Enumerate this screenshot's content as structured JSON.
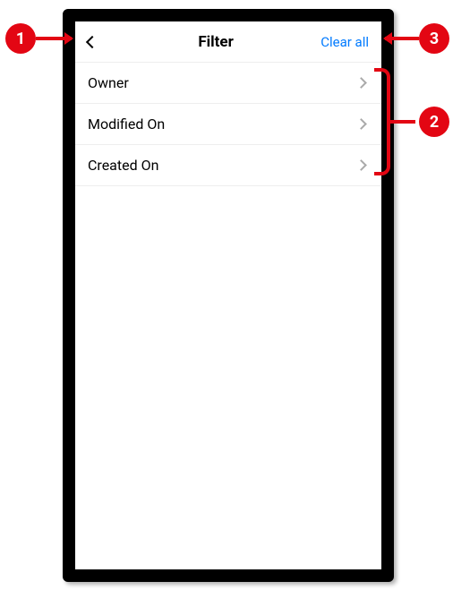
{
  "header": {
    "title": "Filter",
    "clear_all": "Clear all"
  },
  "filters": [
    {
      "label": "Owner"
    },
    {
      "label": "Modified On"
    },
    {
      "label": "Created On"
    }
  ],
  "annotations": {
    "m1": "1",
    "m2": "2",
    "m3": "3"
  }
}
